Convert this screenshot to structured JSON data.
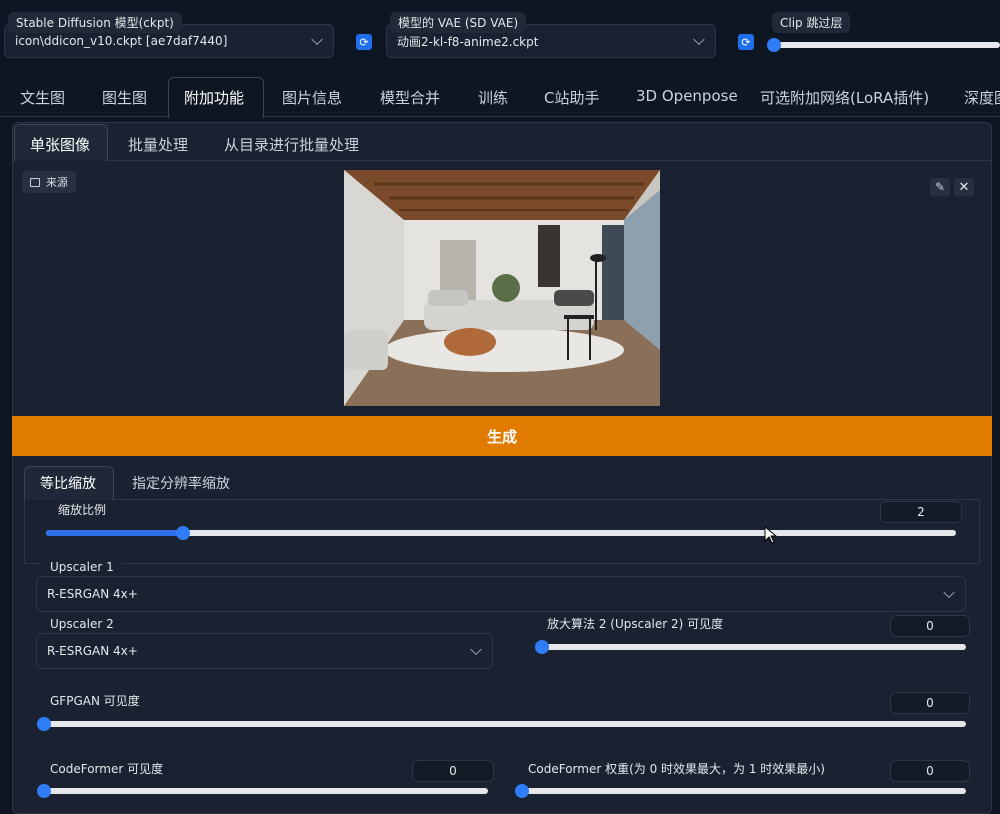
{
  "top": {
    "model_label": "Stable Diffusion 模型(ckpt)",
    "model_value": "icon\\ddicon_v10.ckpt [ae7daf7440]",
    "vae_label": "模型的 VAE (SD VAE)",
    "vae_value": "动画2-kl-f8-anime2.ckpt",
    "clip_label": "Clip 跳过层"
  },
  "main_tabs": [
    "文生图",
    "图生图",
    "附加功能",
    "图片信息",
    "模型合并",
    "训练",
    "C站助手",
    "3D Openpose",
    "可选附加网络(LoRA插件)",
    "深度图"
  ],
  "sub_tabs": [
    "单张图像",
    "批量处理",
    "从目录进行批量处理"
  ],
  "source_label": "来源",
  "generate_label": "生成",
  "resize_tabs": [
    "等比缩放",
    "指定分辨率缩放"
  ],
  "scale": {
    "label": "缩放比例",
    "value": "2",
    "fraction": 0.15
  },
  "upscaler1": {
    "label": "Upscaler 1",
    "value": "R-ESRGAN 4x+"
  },
  "upscaler2": {
    "label": "Upscaler 2",
    "value": "R-ESRGAN 4x+"
  },
  "upscaler2_vis": {
    "label": "放大算法 2 (Upscaler 2) 可见度",
    "value": "0"
  },
  "gfpgan": {
    "label": "GFPGAN 可见度",
    "value": "0"
  },
  "codeformer": {
    "label": "CodeFormer 可见度",
    "value": "0"
  },
  "codeformer_weight": {
    "label": "CodeFormer 权重(为 0 时效果最大，为 1 时效果最小)",
    "value": "0"
  },
  "colors": {
    "accent": "#e07b00",
    "slider": "#2f7cf6",
    "bg": "#0f1623"
  }
}
